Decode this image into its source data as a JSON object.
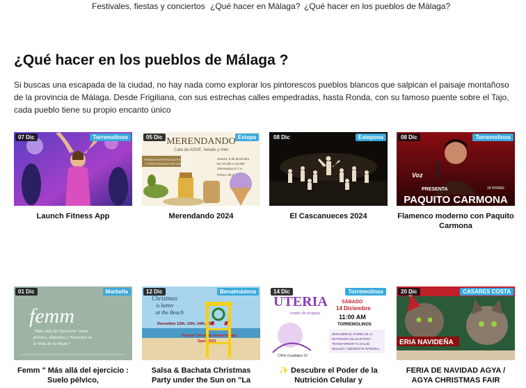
{
  "nav": {
    "items": [
      "Festivales, fiestas y conciertos",
      "¿Qué hacer en Málaga?",
      "¿Qué hacer en los pueblos de Málaga?"
    ]
  },
  "heading": "¿Qué hacer en los pueblos de Málaga ?",
  "intro": "Si buscas una escapada de la ciudad, no hay nada como explorar los pintorescos pueblos blancos que salpican el paisaje montañoso de la provincia de Málaga. Desde Frigiliana, con sus estrechas calles empedradas, hasta Ronda, con su famoso puente sobre el Tajo, cada pueblo tiene su propio encanto único",
  "colors": {
    "location_badge": "#38a9dc",
    "date_badge": "#1a1a1a"
  },
  "events": [
    {
      "date": "07 Dic",
      "location": "Torremolinos",
      "title": "Launch Fitness App",
      "image": "fitness-class-photo"
    },
    {
      "date": "05 Dic",
      "location": "Estepa",
      "title": "Merendando 2024",
      "image": "merendando-poster",
      "poster": {
        "headline": "MERENDANDO",
        "sub": "Cata de AOVE, helado y miel",
        "side1": "PRUEBA NUESTRO ACEITE FRESCO",
        "side2": "Y OTROS PRODUCTOS GOURMET",
        "time1": "Jueves, 5 de diciembre",
        "time2": "De 16:30h a 18:30h",
        "place": "Oleoestepa S.C.A.",
        "price": "Precio: 0€ persona"
      }
    },
    {
      "date": "08 Dic",
      "location": "Estepona",
      "title": "El Cascanueces 2024",
      "image": "ballet-stage-photo"
    },
    {
      "date": "08 Dic",
      "location": "Torremolinos",
      "title": "Flamenco moderno con Paquito Carmona",
      "image": "paquito-carmona-poster",
      "poster": {
        "logo": "Voz",
        "presenta": "PRESENTA",
        "hour": "18 HORAS",
        "name": "PAQUITO CARMONA"
      }
    },
    {
      "date": "01 Dic",
      "location": "Marbella",
      "title": "Femm \" Más allá del ejercicio : Suelo pélvico,",
      "image": "femm-poster",
      "poster": {
        "brand": "femm",
        "line1": "\"Más Allá del Ejercicio: Suelo",
        "line2": "pélvico, abdomen y Nutrición en",
        "line3": "la Vida de la Mujer\""
      }
    },
    {
      "date": "12 Dic",
      "location": "Benalmádena",
      "title": "Salsa & Bachata Christmas Party under the Sun on \"La",
      "image": "beach-christmas-poster",
      "poster": {
        "t1": "Christmas",
        "t2": "is better",
        "t3": "at the Beach",
        "dates": "December 12th, 13th, 14th, 15th",
        "sub": "Tropical Christmas Dance Holiday",
        "year": "Spain 2024"
      }
    },
    {
      "date": "14 Dic",
      "location": "Torremolinos",
      "title": "✨ Descubre el Poder de la Nutrición Celular y",
      "image": "uteria-poster",
      "poster": {
        "brand": "UTERIA",
        "centro": "centro de terapias",
        "day": "SÁBADO",
        "date": "14 Diciembre",
        "time": "11:00 AM",
        "town": "TORREMOLINOS",
        "desc1": "DESCUBRE EL PODER DE LA",
        "desc2": "NUTRICIÓN CELULAR PARA",
        "desc3": "TRANSFORMAR TU SALUD,",
        "desc4": "BELLEZA Y BIENESTAR INTEGRAL",
        "addr": "C/Río Guadalpe 22"
      }
    },
    {
      "date": "20 Dic",
      "location": "CASARES COSTA",
      "title": "FERIA DE NAVIDAD AGYA / AGYA CHRISTMAS FAIR",
      "image": "feria-navidena-poster",
      "poster": {
        "name": "ERIA NAVIDEÑA"
      }
    }
  ]
}
